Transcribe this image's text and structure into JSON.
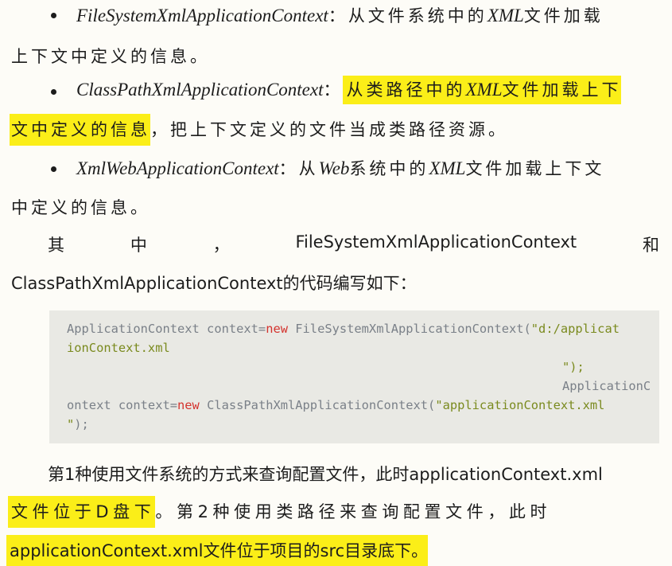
{
  "bullets": [
    {
      "term": "FileSystemXmlApplicationContext",
      "colon": "：",
      "desc_1": "从文件系统中的",
      "xml": "XML",
      "desc_2": "文件加载",
      "cont": "上下文中定义的信息。"
    },
    {
      "term": "ClassPathXmlApplicationContext",
      "colon": "：",
      "hl_1": "从类路径中的",
      "xml": "XML",
      "hl_2": "文件加载上下",
      "cont_hl": "文中定义的信息",
      "cont_rest": "，把上下文定义的文件当成类路径资源。"
    },
    {
      "term": "XmlWebApplicationContext",
      "colon": "：",
      "desc_1": "从",
      "web": "Web",
      "desc_2": "系统中的",
      "xml": "XML",
      "desc_3": "文件加载上下文",
      "cont": "中定义的信息。"
    }
  ],
  "para1": {
    "w1": "其",
    "w2": "中",
    "w3": "，",
    "w4": "FileSystemXmlApplicationContext",
    "w5": "和",
    "line2": "ClassPathXmlApplicationContext的代码编写如下："
  },
  "code": {
    "l1_a": "ApplicationContext context=",
    "l1_kw": "new",
    "l1_b": " FileSystemXmlApplicationContext(",
    "l1_str": "\"d:/applicat",
    "l2_str": "ionContext.xml",
    "l3": "\");",
    "l4": "ApplicationC",
    "l5_a": "ontext context=",
    "l5_kw": "new",
    "l5_b": " ClassPathXmlApplicationContext(",
    "l5_str": "\"applicationContext.xml",
    "l6_str": "\"",
    "l6_b": ");"
  },
  "para2": {
    "line1": "第1种使用文件系统的方式来查询配置文件，此时applicationContext.xml",
    "line2_hl": "文件位于D盘下",
    "line2_rest": "。第2种使用类路径来查询配置文件，此时",
    "line3_hl": "applicationContext.xml文件位于项目的src目录底下。"
  }
}
